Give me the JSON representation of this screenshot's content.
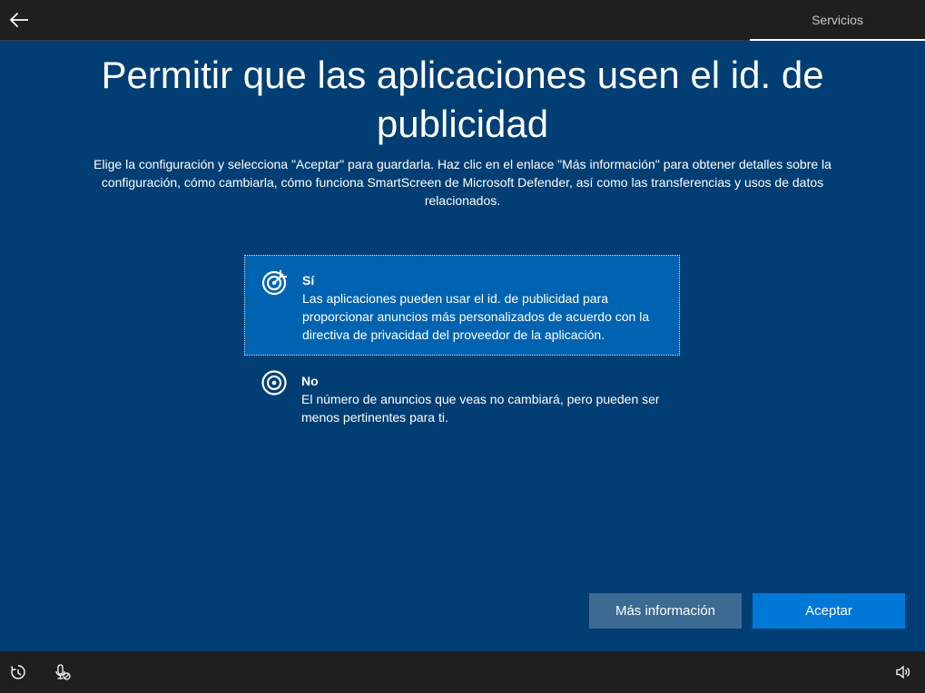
{
  "header": {
    "back_icon": "back-arrow-icon",
    "tab_label": "Servicios"
  },
  "page": {
    "title": "Permitir que las aplicaciones usen el id. de publicidad",
    "description": "Elige la configuración y selecciona \"Aceptar\" para guardarla. Haz clic en el enlace \"Más información\" para obtener detalles sobre la configuración, cómo cambiarla, cómo funciona SmartScreen de Microsoft Defender, así como las transferencias y usos de datos relacionados."
  },
  "options": [
    {
      "title": "Sí",
      "description": "Las aplicaciones pueden usar el id. de publicidad para proporcionar anuncios más personalizados de acuerdo con la directiva de privacidad del proveedor de la aplicación.",
      "icon": "target-arrow-icon",
      "selected": true
    },
    {
      "title": "No",
      "description": "El número de anuncios que veas no cambiará, pero pueden ser menos pertinentes para ti.",
      "icon": "target-icon",
      "selected": false
    }
  ],
  "buttons": {
    "more_info": "Más información",
    "accept": "Aceptar"
  },
  "tray": {
    "icons": [
      "ease-of-access-icon",
      "microphone-muted-icon",
      "volume-icon"
    ]
  },
  "colors": {
    "background": "#003e74",
    "selected_option": "#0063b1",
    "accept_button": "#0078d7",
    "more_info_button": "#3d6a93",
    "bars": "#1f1f1f"
  }
}
